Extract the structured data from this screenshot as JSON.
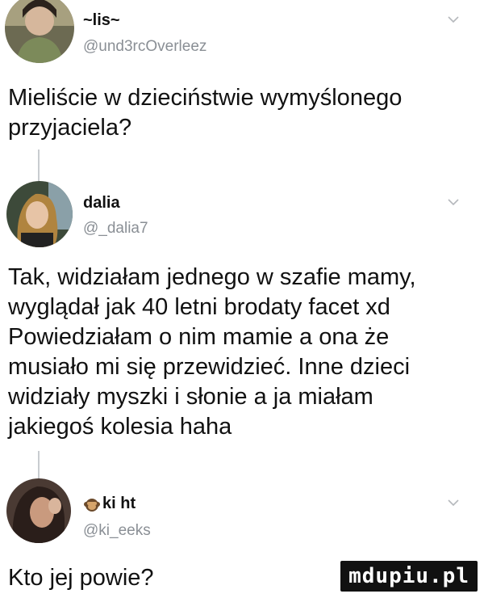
{
  "tweets": [
    {
      "name": "~lis~",
      "handle": "@und3rcOverleez",
      "text": "Mieliście w dzieciństwie wymyślonego\nprzyjaciela?",
      "avatar_icon": "user-photo-avatar",
      "menu_icon": "chevron-down-icon"
    },
    {
      "name": "dalia",
      "handle": "@_dalia7",
      "text": "Tak, widziałam jednego w szafie mamy,\nwyglądał jak 40 letni brodaty facet xd\nPowiedziałam o nim mamie a ona że\nmusiało mi się przewidzieć. Inne dzieci\nwidziały myszki i słonie a ja miałam\njakiegoś kolesia haha",
      "avatar_icon": "user-photo-avatar",
      "menu_icon": "chevron-down-icon"
    },
    {
      "name": "ki ht",
      "name_emoji_icon": "monkey-emoji-icon",
      "handle": "@ki_eeks",
      "text": "Kto jej powie?",
      "avatar_icon": "user-photo-avatar",
      "menu_icon": "chevron-down-icon"
    }
  ],
  "watermark": "mdupiu.pl",
  "colors": {
    "text": "#111111",
    "handle": "#8a8f95",
    "thread_line": "#c9ccd0",
    "watermark_bg": "#111111"
  }
}
